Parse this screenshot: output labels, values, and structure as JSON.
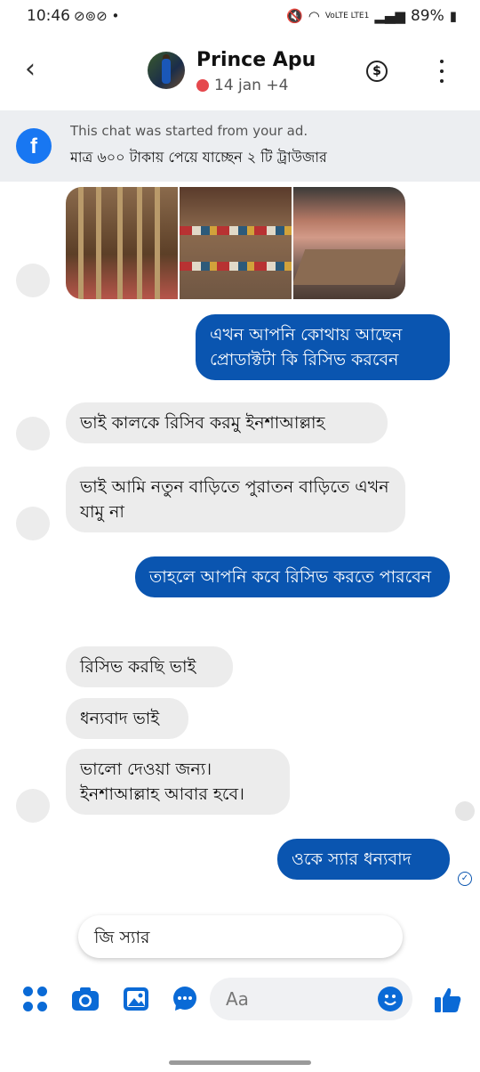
{
  "status_bar": {
    "time": "10:46",
    "notification_icons": "⊘⊚⊘ •",
    "network": "VoLTE LTE1",
    "battery": "89%"
  },
  "header": {
    "name": "Prince Apu",
    "subtitle": "14 jan +4",
    "back_icon": "back-arrow-icon",
    "payment_icon": "dollar-icon",
    "more_icon": "more-vertical-icon"
  },
  "ad_banner": {
    "line1": "This chat was started from your ad.",
    "line2": "মাত্র ৬০০ টাকায় পেয়ে যাচ্ছেন ২ টি ট্রাউজার"
  },
  "messages": [
    {
      "side": "out",
      "text": "এখন আপনি কোথায় আছেন প্রোডাক্টটা কি রিসিভ করবেন"
    },
    {
      "side": "in",
      "text": "ভাই কালকে রিসিব করমু ইনশাআল্লাহ"
    },
    {
      "side": "in",
      "text": "ভাই আমি নতুন বাড়িতে পুরাতন বাড়িতে এখন যামু না"
    },
    {
      "side": "out",
      "text": "তাহলে আপনি কবে রিসিভ করতে পারবেন"
    },
    {
      "side": "in",
      "text": "রিসিভ করছি ভাই"
    },
    {
      "side": "in",
      "text": "ধন্যবাদ ভাই"
    },
    {
      "side": "in",
      "text": "ভালো দেওয়া জন্য। ইনশাআল্লাহ আবার হবে।"
    },
    {
      "side": "out",
      "text": "ওকে স্যার ধন্যবাদ"
    }
  ],
  "suggestion": "জি স্যার",
  "composer": {
    "placeholder": "Aa"
  },
  "colors": {
    "accent": "#0a55b0",
    "incoming_bubble": "#ececec",
    "online_dot": "#e5484d"
  }
}
